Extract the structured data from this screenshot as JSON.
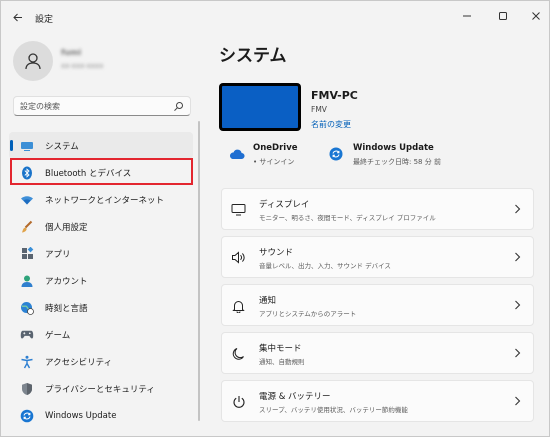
{
  "window": {
    "app_title": "設定",
    "back_icon": "back-arrow-icon",
    "controls": [
      "minimize-icon",
      "maximize-icon",
      "close-icon"
    ]
  },
  "profile": {
    "name": "fumi",
    "email": "xx-xxx-xxxx"
  },
  "search": {
    "placeholder": "設定の検索"
  },
  "sidebar": {
    "items": [
      {
        "label": "システム",
        "icon": "display-icon",
        "selected": true
      },
      {
        "label": "Bluetooth とデバイス",
        "icon": "bluetooth-icon",
        "highlighted": true
      },
      {
        "label": "ネットワークとインターネット",
        "icon": "wifi-icon"
      },
      {
        "label": "個人用設定",
        "icon": "brush-icon"
      },
      {
        "label": "アプリ",
        "icon": "apps-icon"
      },
      {
        "label": "アカウント",
        "icon": "account-icon"
      },
      {
        "label": "時刻と言語",
        "icon": "globe-clock-icon"
      },
      {
        "label": "ゲーム",
        "icon": "gamepad-icon"
      },
      {
        "label": "アクセシビリティ",
        "icon": "accessibility-icon"
      },
      {
        "label": "プライバシーとセキュリティ",
        "icon": "shield-icon"
      },
      {
        "label": "Windows Update",
        "icon": "windows-update-icon"
      }
    ]
  },
  "main": {
    "title": "システム",
    "device": {
      "name": "FMV-PC",
      "model": "FMV",
      "rename_link": "名前の変更"
    },
    "onedrive": {
      "title": "OneDrive",
      "status": "• サインイン"
    },
    "windows_update": {
      "title": "Windows Update",
      "status": "最終チェック日時: 58 分 前"
    },
    "cards": [
      {
        "title": "ディスプレイ",
        "desc": "モニター、明るさ、夜間モード、ディスプレイ プロファイル",
        "icon": "monitor-icon"
      },
      {
        "title": "サウンド",
        "desc": "音量レベル、出力、入力、サウンド デバイス",
        "icon": "speaker-icon"
      },
      {
        "title": "通知",
        "desc": "アプリとシステムからのアラート",
        "icon": "bell-icon"
      },
      {
        "title": "集中モード",
        "desc": "通知、自動規則",
        "icon": "moon-icon"
      },
      {
        "title": "電源 & バッテリー",
        "desc": "スリープ、バッテリ使用状況、バッテリー節約機能",
        "icon": "power-icon"
      }
    ]
  },
  "colors": {
    "accent": "#005fb8",
    "highlight_border": "#e3262f",
    "device_screen": "#0a5fc4"
  }
}
